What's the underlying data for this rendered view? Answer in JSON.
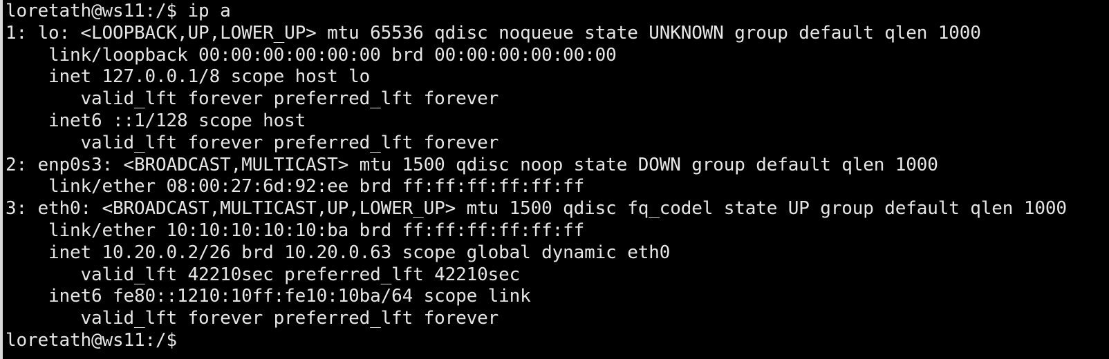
{
  "terminal": {
    "lines": [
      "loretath@ws11:/$ ip a",
      "1: lo: <LOOPBACK,UP,LOWER_UP> mtu 65536 qdisc noqueue state UNKNOWN group default qlen 1000",
      "    link/loopback 00:00:00:00:00:00 brd 00:00:00:00:00:00",
      "    inet 127.0.0.1/8 scope host lo",
      "       valid_lft forever preferred_lft forever",
      "    inet6 ::1/128 scope host",
      "       valid_lft forever preferred_lft forever",
      "2: enp0s3: <BROADCAST,MULTICAST> mtu 1500 qdisc noop state DOWN group default qlen 1000",
      "    link/ether 08:00:27:6d:92:ee brd ff:ff:ff:ff:ff:ff",
      "3: eth0: <BROADCAST,MULTICAST,UP,LOWER_UP> mtu 1500 qdisc fq_codel state UP group default qlen 1000",
      "    link/ether 10:10:10:10:10:ba brd ff:ff:ff:ff:ff:ff",
      "    inet 10.20.0.2/26 brd 10.20.0.63 scope global dynamic eth0",
      "       valid_lft 42210sec preferred_lft 42210sec",
      "    inet6 fe80::1210:10ff:fe10:10ba/64 scope link",
      "       valid_lft forever preferred_lft forever"
    ],
    "prompt": "loretath@ws11:/$"
  },
  "colors": {
    "background": "#000000",
    "foreground": "#e6e6e6"
  }
}
